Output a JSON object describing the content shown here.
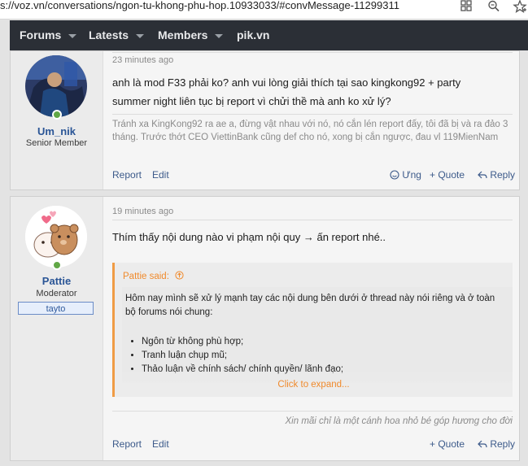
{
  "browser": {
    "url": "s://voz.vn/conversations/ngon-tu-khong-phu-hop.10933033/#convMessage-11299311",
    "icons": [
      "grid-icon",
      "zoom-icon",
      "bookmark-star-icon"
    ]
  },
  "nav": {
    "items": [
      {
        "label": "Forums"
      },
      {
        "label": "Latests"
      },
      {
        "label": "Members"
      },
      {
        "label": "pik.vn"
      }
    ]
  },
  "posts": [
    {
      "user": {
        "name": "Um_nik",
        "title": "Senior Member"
      },
      "time": "23 minutes ago",
      "message": "anh là mod F33 phải ko? anh vui lòng giải thích tại sao kingkong92 + party summer night liên tục bị report vì chửi thề mà anh ko xử lý?",
      "signature": "Tránh xa KingKong92 ra ae a, đừng vật nhau với nó, nó cắn lén report đấy, tôi đã bị và ra đảo 3 tháng. Trước thớt CEO ViettinBank cũng def cho nó, xong bị cắn ngược, đau vl 119MienNam",
      "actions": {
        "report": "Report",
        "edit": "Edit",
        "ung": "Ưng",
        "quote": "+ Quote",
        "reply": "Reply"
      }
    },
    {
      "user": {
        "name": "Pattie",
        "title": "Moderator",
        "banner": "tayto"
      },
      "time": "19 minutes ago",
      "message": "Thím thấy nội dung nào vi phạm nội quy → ấn report nhé..",
      "quote": {
        "author": "Pattie said:",
        "intro": "Hôm nay mình sẽ xử lý mạnh tay các nội dung bên dưới ở thread này nói riêng và ở toàn bộ forums nói chung:",
        "items": [
          "Ngôn từ không phù hợp;",
          "Tranh luận chụp mũ;",
          "Thảo luận về chính sách/ chính quyền/ lãnh đạo;"
        ],
        "expand": "Click to expand..."
      },
      "signature": "Xin mãi chỉ là một cánh hoa nhỏ bé góp hương cho đời",
      "actions": {
        "report": "Report",
        "edit": "Edit",
        "quote": "+ Quote",
        "reply": "Reply"
      }
    }
  ],
  "colors": {
    "accent": "#f09c45",
    "link": "#3c5a8a",
    "navbar": "#2b2f36",
    "online": "#61a746"
  }
}
